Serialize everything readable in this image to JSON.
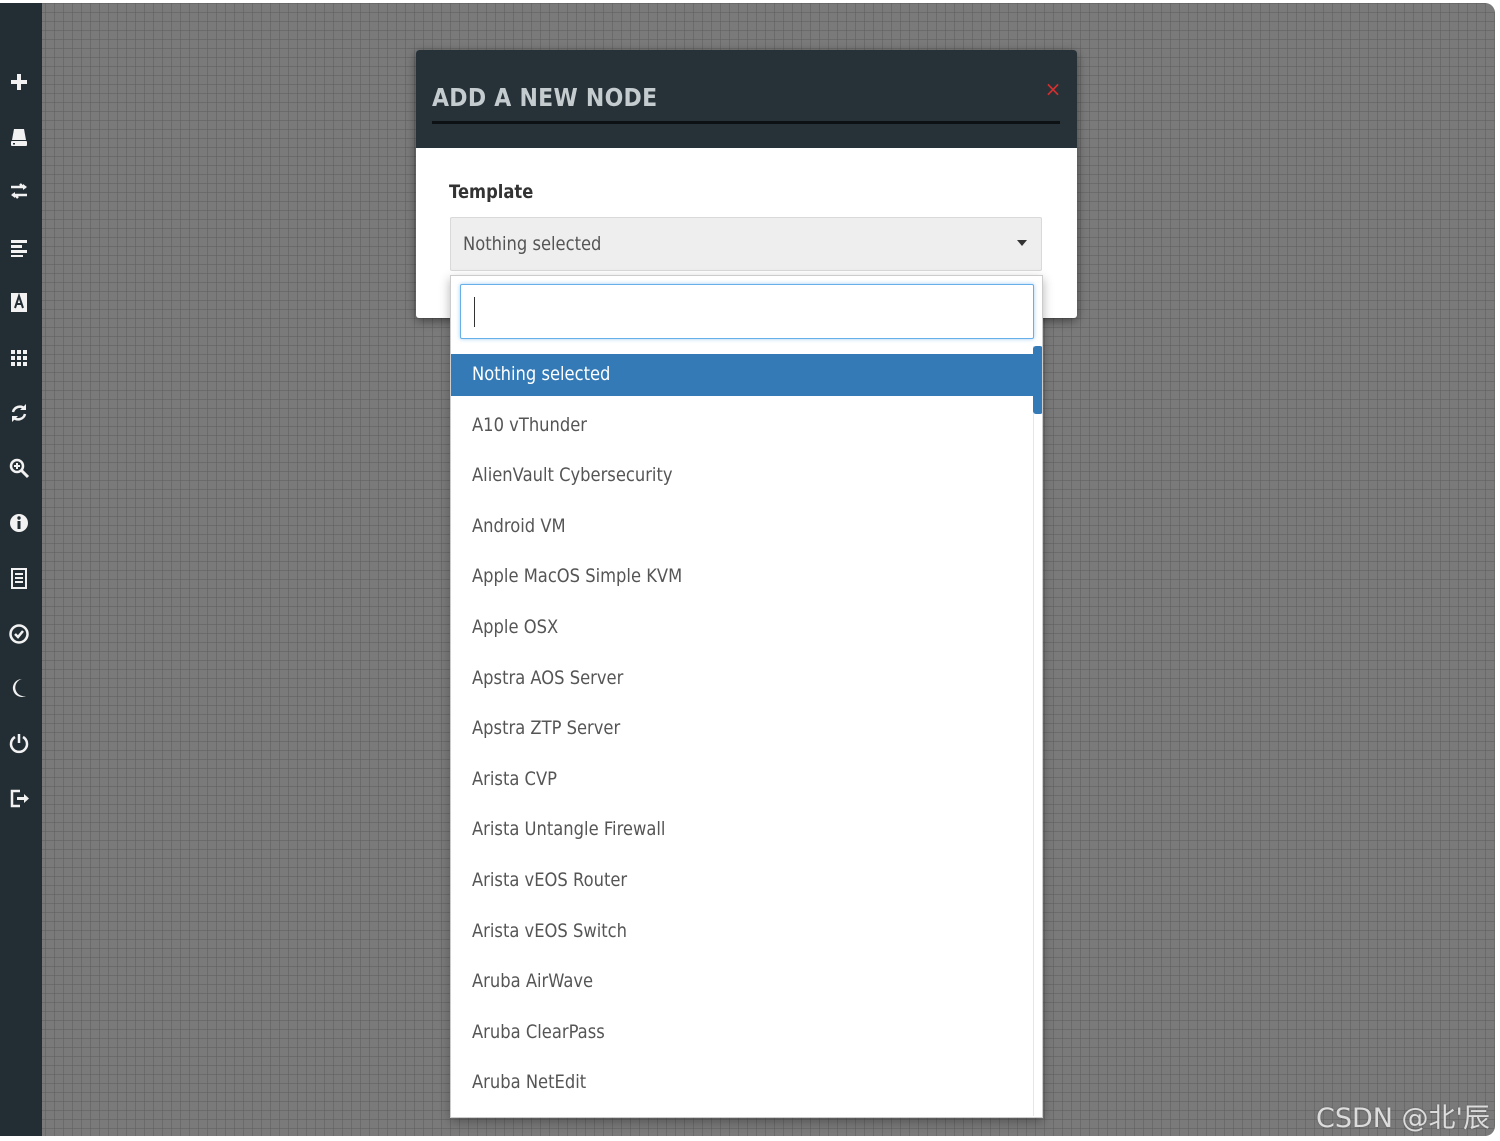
{
  "modal": {
    "title": "ADD A NEW NODE",
    "close_symbol": "×",
    "template_label": "Template",
    "select_value": "Nothing selected",
    "search_value": ""
  },
  "options": [
    "Nothing selected",
    "A10 vThunder",
    "AlienVault Cybersecurity",
    "Android VM",
    "Apple MacOS Simple KVM",
    "Apple OSX",
    "Apstra AOS Server",
    "Apstra ZTP Server",
    "Arista CVP",
    "Arista Untangle Firewall",
    "Arista vEOS Router",
    "Arista vEOS Switch",
    "Aruba AirWave",
    "Aruba ClearPass",
    "Aruba NetEdit"
  ],
  "selected_option_index": 0,
  "sidebar_icons": [
    "add-icon",
    "storage-icon",
    "transfer-icon",
    "align-left-icon",
    "text-box-icon",
    "grid-icon",
    "refresh-icon",
    "zoom-in-icon",
    "info-icon",
    "list-icon",
    "check-circle-icon",
    "moon-icon",
    "power-icon",
    "logout-icon"
  ],
  "colors": {
    "sidebar": "#232e34",
    "header": "#263238",
    "accent": "#337ab7",
    "close": "#d32f2f"
  },
  "watermark": "CSDN @北'辰"
}
